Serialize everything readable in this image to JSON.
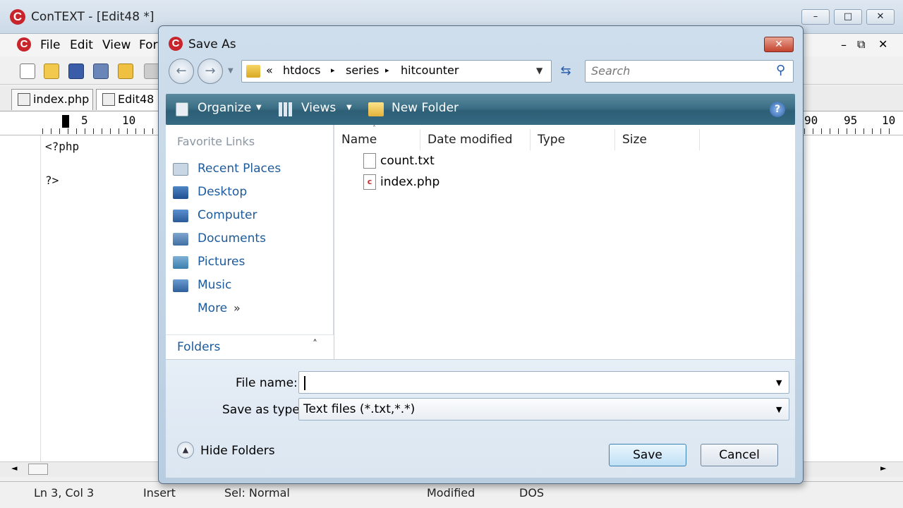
{
  "window": {
    "title": "ConTEXT - [Edit48 *]",
    "logo_letter": "C"
  },
  "menu": {
    "items": [
      "File",
      "Edit",
      "View",
      "For"
    ]
  },
  "tabs": [
    {
      "label": "index.php"
    },
    {
      "label": "Edit48"
    }
  ],
  "ruler": {
    "left_nums": [
      "5",
      "10"
    ],
    "right_nums": [
      "90",
      "95",
      "10"
    ]
  },
  "editor": {
    "lines": [
      "<?php",
      "",
      "?>"
    ]
  },
  "status": {
    "position": "Ln 3, Col 3",
    "mode": "Insert",
    "selection": "Sel: Normal",
    "modified": "Modified",
    "format": "DOS"
  },
  "dialog": {
    "title": "Save As",
    "breadcrumb": [
      "«",
      "htdocs",
      "series",
      "hitcounter"
    ],
    "search_placeholder": "Search",
    "commands": {
      "organize": "Organize",
      "views": "Views",
      "new_folder": "New Folder"
    },
    "left_pane": {
      "header": "Favorite Links",
      "links": [
        "Recent Places",
        "Desktop",
        "Computer",
        "Documents",
        "Pictures",
        "Music"
      ],
      "more": "More",
      "folders": "Folders"
    },
    "columns": [
      "Name",
      "Date modified",
      "Type",
      "Size"
    ],
    "files": [
      {
        "name": "count.txt",
        "kind": "text-file-icon"
      },
      {
        "name": "index.php",
        "kind": "context-file-icon"
      }
    ],
    "file_name_label": "File name:",
    "file_name_value": "",
    "save_type_label": "Save as type:",
    "save_type_value": "Text files (*.txt,*.*)",
    "hide_folders": "Hide Folders",
    "save": "Save",
    "cancel": "Cancel"
  }
}
